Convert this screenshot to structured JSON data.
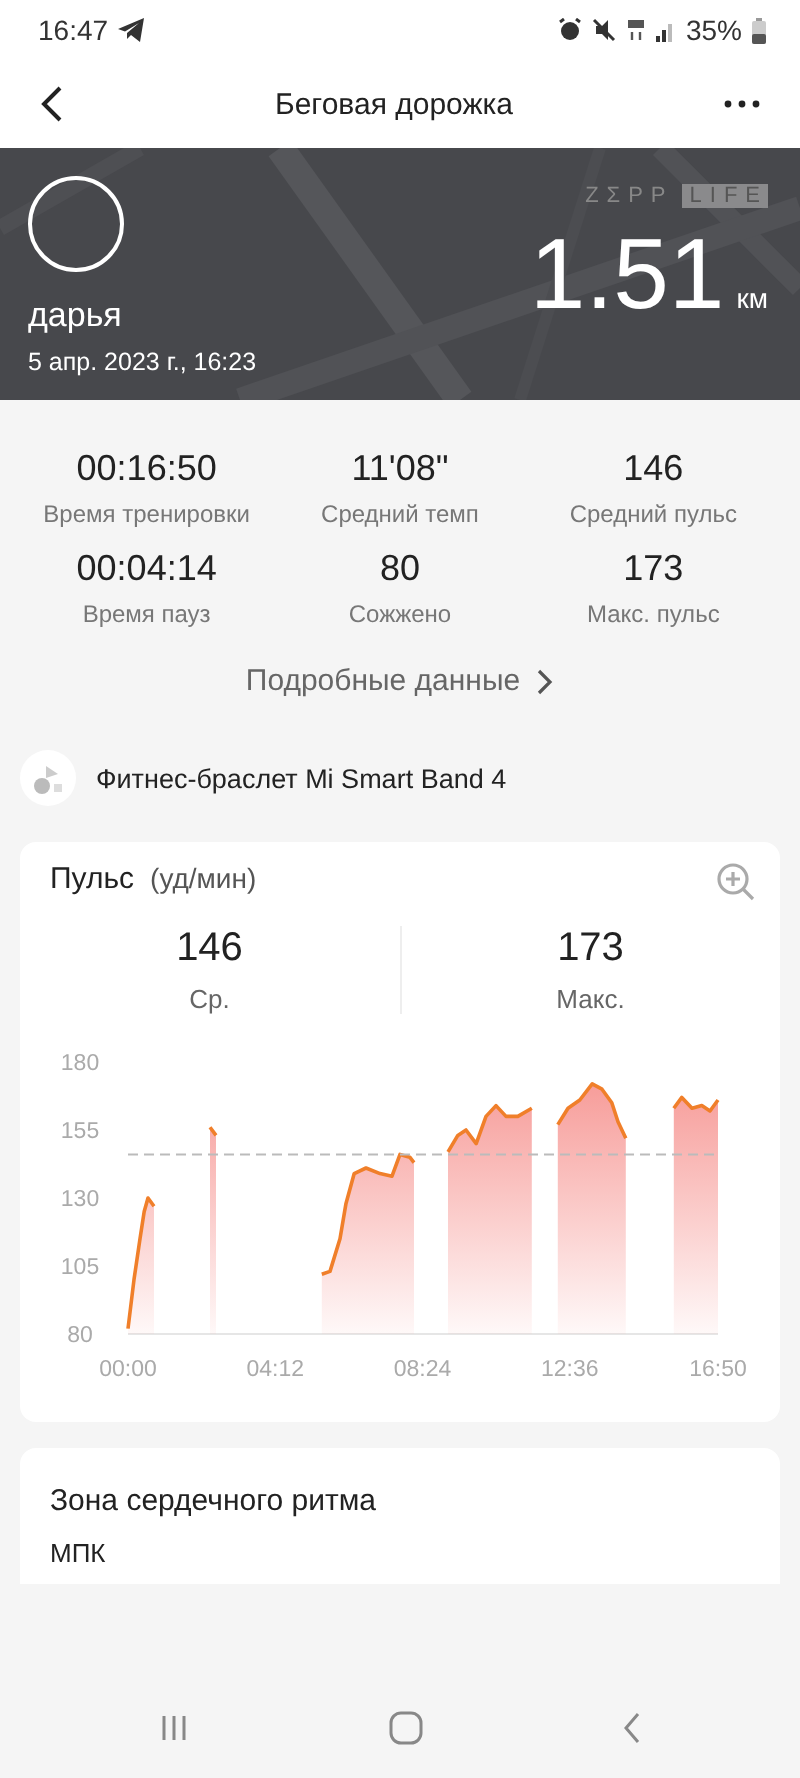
{
  "status_bar": {
    "time": "16:47",
    "battery": "35%"
  },
  "header": {
    "title": "Беговая дорожка"
  },
  "banner": {
    "brand_left": "ZΣPP",
    "brand_right": "LIFE",
    "user": "дарья",
    "date": "5 апр. 2023 г., 16:23",
    "distance": "1.51",
    "unit": "км"
  },
  "stats": [
    {
      "value": "00:16:50",
      "label": "Время тренировки"
    },
    {
      "value": "11'08\"",
      "label": "Средний темп"
    },
    {
      "value": "146",
      "label": "Средний пульс"
    },
    {
      "value": "00:04:14",
      "label": "Время пауз"
    },
    {
      "value": "80",
      "label": "Сожжено"
    },
    {
      "value": "173",
      "label": "Макс. пульс"
    }
  ],
  "details_link": "Подробные данные",
  "device": "Фитнес-браслет Mi Smart Band 4",
  "pulse_card": {
    "title": "Пульс",
    "unit": "(уд/мин)",
    "summary": [
      {
        "value": "146",
        "label": "Ср."
      },
      {
        "value": "173",
        "label": "Макс."
      }
    ],
    "chart_data": {
      "type": "area",
      "x": [
        0,
        0.17,
        0.34,
        0.46,
        0.57,
        0.74,
        2.34,
        2.51,
        5.53,
        5.76,
        6.05,
        6.22,
        6.45,
        6.79,
        7.19,
        7.53,
        7.76,
        8.04,
        8.16,
        9.13,
        9.41,
        9.64,
        9.93,
        10.21,
        10.5,
        10.78,
        11.12,
        11.52,
        12.26,
        12.55,
        12.89,
        13.24,
        13.52,
        13.8,
        13.98,
        14.2,
        15.57,
        15.8,
        16.09,
        16.37,
        16.6,
        16.83
      ],
      "series": [
        {
          "color": "#f07f2a",
          "values": [
            82,
            100,
            115,
            125,
            130,
            127,
            156,
            153,
            102,
            103,
            115,
            128,
            139,
            141,
            139,
            138,
            146,
            145,
            143,
            147,
            153,
            155,
            150,
            160,
            164,
            160,
            160,
            163,
            157,
            163,
            166,
            172,
            170,
            165,
            158,
            152,
            163,
            167,
            163,
            164,
            162,
            166
          ]
        }
      ],
      "xlim": [
        0,
        16.83
      ],
      "ylim": [
        80,
        180
      ],
      "xticks": [
        {
          "value": 0,
          "label": "00:00"
        },
        {
          "value": 4.2,
          "label": "04:12"
        },
        {
          "value": 8.4,
          "label": "08:24"
        },
        {
          "value": 12.6,
          "label": "12:36"
        },
        {
          "value": 16.83,
          "label": "16:50"
        }
      ],
      "yticks": [
        80,
        105,
        130,
        155,
        180
      ],
      "ref_lines": [
        {
          "axis": "y",
          "value": 146
        }
      ]
    }
  },
  "zone_card": {
    "title": "Зона сердечного ритма",
    "subtitle": "МПК"
  }
}
